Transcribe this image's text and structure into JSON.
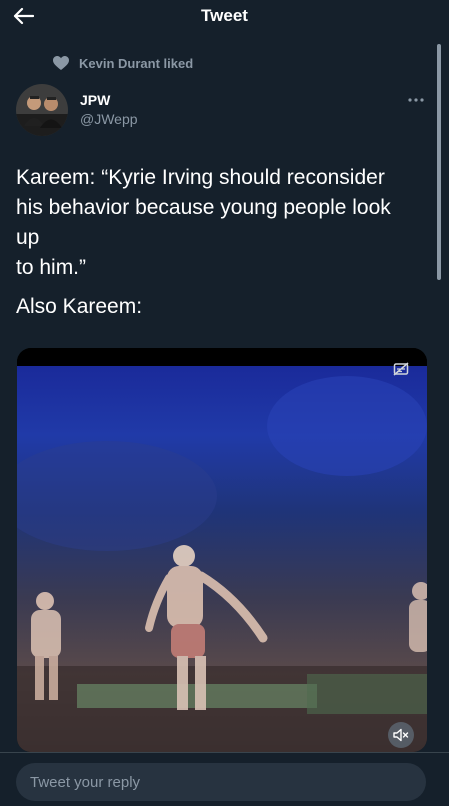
{
  "header": {
    "title": "Tweet"
  },
  "social_context": {
    "text": "Kevin Durant liked"
  },
  "author": {
    "name": "JPW",
    "handle": "@JWepp"
  },
  "tweet": {
    "lines": [
      "Kareem: “Kyrie Irving should reconsider",
      "his behavior because young people look",
      "up",
      "to him.”"
    ],
    "line2": "Also Kareem:"
  },
  "reply": {
    "placeholder": "Tweet your reply"
  },
  "colors": {
    "background": "#15202b",
    "secondary_text": "#8b98a5",
    "input_background": "#273340",
    "divider": "#38444d"
  },
  "icons": {
    "back": "arrow-left-icon",
    "liked": "heart-icon",
    "more": "more-dots-icon",
    "captions": "captions-off-icon",
    "mute": "volume-mute-icon"
  }
}
